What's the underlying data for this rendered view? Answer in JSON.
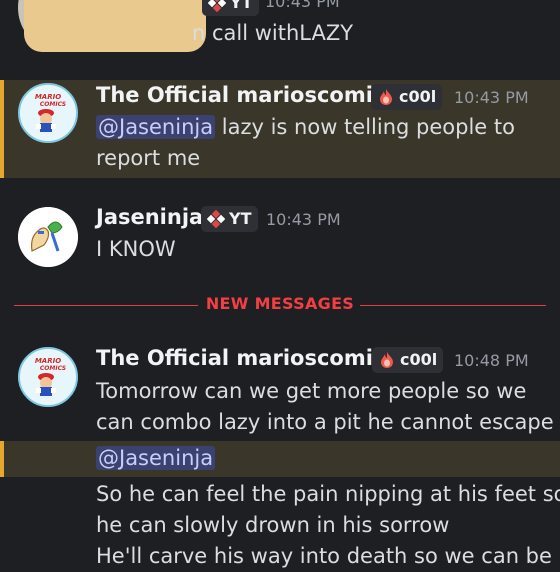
{
  "top_partial": {
    "tag_text": "YT",
    "time": "10:43 PM",
    "text": "n call withLAZY"
  },
  "messages": [
    {
      "author": "The Official marioscomics",
      "tag": "c00l",
      "time": "10:43 PM",
      "mention": "@Jaseninja",
      "line1_rest": " lazy is now telling people to",
      "line2": "report me"
    },
    {
      "author": "Jaseninja",
      "tag": "YT",
      "time": "10:43 PM",
      "line1": "I KNOW"
    },
    {
      "author": "The Official marioscomics",
      "tag": "c00l",
      "time": "10:48 PM",
      "line1": "Tomorrow can we get more people so we",
      "line2": "can combo lazy into a pit he cannot escape",
      "mention": "@Jaseninja",
      "line3": "So he can feel the pain nipping at his feet so",
      "line4": "he can slowly drown in his sorrow",
      "line5_partial": "He'll carve his way into death so we can be"
    }
  ],
  "divider": {
    "label": "NEW MESSAGES"
  },
  "avatar_text": {
    "mario_top": "MARIO",
    "mario_bottom": "COMICS"
  },
  "colors": {
    "background": "#1e1f22",
    "mention_highlight": "#3a3629",
    "mention_bar": "#e5a72e",
    "mention_pill": "#3c4270",
    "new_messages": "#f23f43"
  }
}
